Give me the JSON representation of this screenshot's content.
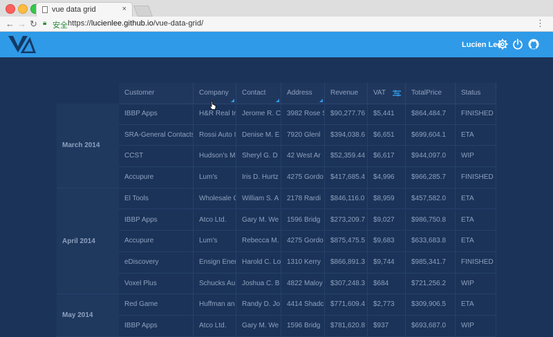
{
  "browser": {
    "tab_title": "vue data grid",
    "tab_close": "×",
    "secure_label": "安全",
    "url_scheme": "https://",
    "url_host": "lucienlee.github.io",
    "url_path": "/vue-data-grid/"
  },
  "app": {
    "user_name": "Lucien Lee",
    "accent_color": "#2f9ae8",
    "background_color": "#1b3358"
  },
  "grid": {
    "columns": [
      "Customer",
      "Company",
      "Contact",
      "Address",
      "Revenue",
      "VAT",
      "TotalPrice",
      "Status"
    ],
    "groups": [
      {
        "label": "March 2014",
        "rows": [
          [
            "IBBP Apps",
            "H&R Real Ir",
            "Jerome R. C",
            "3982 Rose S",
            "$90,277.76",
            "$5,441",
            "$864,484.7",
            "FINISHED"
          ],
          [
            "SRA-General Contacts",
            "Rossi Auto I",
            "Denise M. E",
            "7920 Glenl",
            "$394,038.6",
            "$6,651",
            "$699,604.1",
            "ETA"
          ],
          [
            "CCST",
            "Hudson's M",
            "Sheryl G. D",
            "42 West Ar",
            "$52,359.44",
            "$6,617",
            "$944,097.0",
            "WIP"
          ],
          [
            "Accupure",
            "Lum's",
            "Iris D. Hurtz",
            "4275 Gordo",
            "$417,685.4",
            "$4,996",
            "$966,285.7",
            "FINISHED"
          ]
        ]
      },
      {
        "label": "April 2014",
        "rows": [
          [
            "El Tools",
            "Wholesale C",
            "William S. A",
            "2178 Rardi",
            "$846,116.0",
            "$8,959",
            "$457,582.0",
            "ETA"
          ],
          [
            "IBBP Apps",
            "Atco Ltd.",
            "Gary M. We",
            "1596 Bridg",
            "$273,209.7",
            "$9,027",
            "$986,750.8",
            "ETA"
          ],
          [
            "Accupure",
            "Lum's",
            "Rebecca M.",
            "4275 Gordo",
            "$875,475.5",
            "$9,683",
            "$633,683.8",
            "ETA"
          ],
          [
            "eDiscovery",
            "Ensign Ener",
            "Harold C. Lo",
            "1310 Kerry",
            "$866,891.3",
            "$9,744",
            "$985,341.7",
            "FINISHED"
          ],
          [
            "Voxel Plus",
            "Schucks Au",
            "Joshua C. B",
            "4822 Maloy",
            "$307,248.3",
            "$684",
            "$721,256.2",
            "WIP"
          ]
        ]
      },
      {
        "label": "May 2014",
        "rows": [
          [
            "Red Game",
            "Huffman an",
            "Randy D. Jo",
            "4414 Shadc",
            "$771,609.4",
            "$2,773",
            "$309,906.5",
            "ETA"
          ],
          [
            "IBBP Apps",
            "Atco Ltd.",
            "Gary M. We",
            "1596 Bridg",
            "$781,620.8",
            "$937",
            "$693,687.0",
            "WIP"
          ]
        ]
      }
    ]
  }
}
